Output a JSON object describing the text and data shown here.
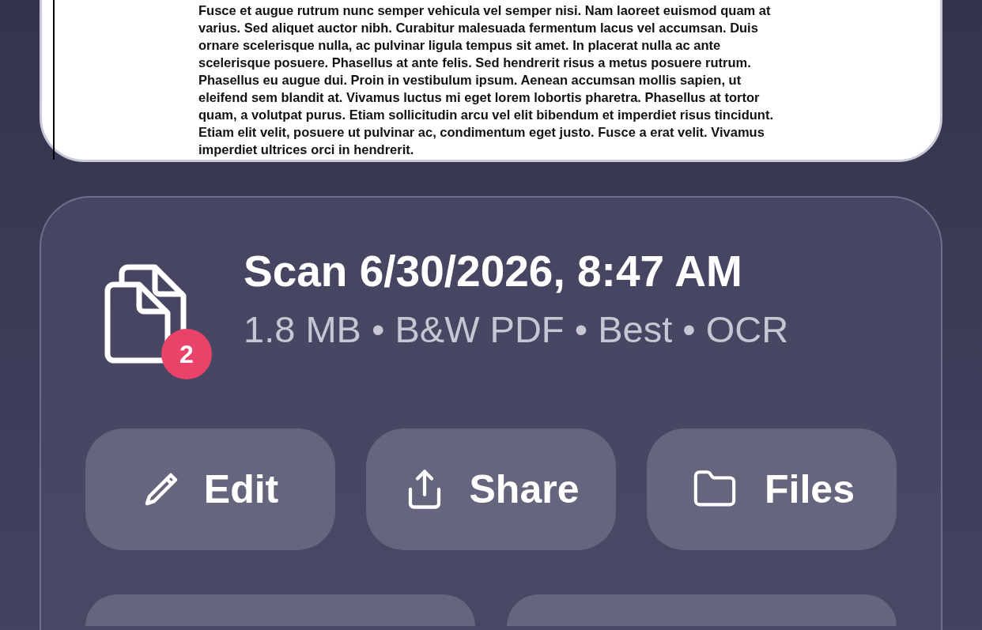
{
  "document": {
    "lines": [
      "Fusce et augue rutrum nunc semper vehicula vel semper nisi. Nam laoreet euismod quam at",
      "varius. Sed aliquet auctor nibh. Curabitur malesuada fermentum lacus vel accumsan. Duis",
      "ornare scelerisque nulla, ac pulvinar ligula tempus sit amet. In placerat nulla ac ante",
      "scelerisque posuere. Phasellus at ante felis. Sed hendrerit risus a metus posuere rutrum.",
      "Phasellus eu augue dui. Proin in vestibulum ipsum. Aenean accumsan mollis sapien, ut",
      "eleifend sem blandit at. Vivamus luctus mi eget lorem lobortis pharetra. Phasellus at tortor",
      "quam, a volutpat purus. Etiam sollicitudin arcu vel elit bibendum et imperdiet risus tincidunt.",
      "Etiam elit velit, posuere ut pulvinar ac, condimentum eget justo. Fusce a erat velit. Vivamus",
      "imperdiet ultrices orci in hendrerit."
    ]
  },
  "scan": {
    "title": "Scan 6/30/2026, 8:47 AM",
    "details": "1.8 MB • B&W PDF • Best • OCR",
    "page_count": "2"
  },
  "actions": [
    {
      "label": "Edit",
      "kind": "edit"
    },
    {
      "label": "Share",
      "kind": "share"
    },
    {
      "label": "Files",
      "kind": "files"
    }
  ]
}
